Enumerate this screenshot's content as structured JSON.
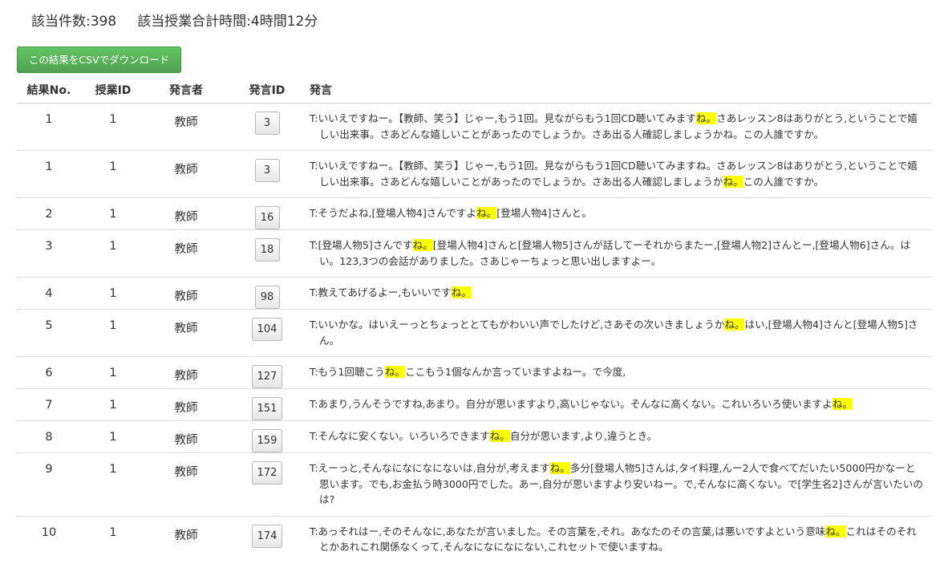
{
  "summary": {
    "count_label": "該当件数:",
    "count_value": "398",
    "time_label": "該当授業合計時間:",
    "time_value": "4時間12分"
  },
  "csv_button_label": "この結果をCSVでダウンロード",
  "table": {
    "headers": [
      "結果No.",
      "授業ID",
      "発言者",
      "発言ID",
      "発言"
    ],
    "rows": [
      {
        "no": "1",
        "class_id": "1",
        "speaker": "教師",
        "utt_id": "3",
        "pre": "T:いいえですねー。【教師、笑う】じゃー,もう1回。見ながらもう1回CD聴いてみます",
        "hit": "ね。",
        "post": "さあレッスン8はありがとう,ということで嬉しい出来事。さあどんな嬉しいことがあったのでしょうか。さあ出る人確認しましょうかね。この人誰ですか。"
      },
      {
        "no": "1",
        "class_id": "1",
        "speaker": "教師",
        "utt_id": "3",
        "pre": "T:いいえですねー。【教師、笑う】じゃー,もう1回。見ながらもう1回CD聴いてみますね。さあレッスン8はありがとう,ということで嬉しい出来事。さあどんな嬉しいことがあったのでしょうか。さあ出る人確認しましょうか",
        "hit": "ね。",
        "post": "この人誰ですか。"
      },
      {
        "no": "2",
        "class_id": "1",
        "speaker": "教師",
        "utt_id": "16",
        "pre": "T:そうだよね,[登場人物4]さんですよ",
        "hit": "ね。",
        "post": "[登場人物4]さんと。"
      },
      {
        "no": "3",
        "class_id": "1",
        "speaker": "教師",
        "utt_id": "18",
        "pre": "T:[登場人物5]さんです",
        "hit": "ね。",
        "post": "[登場人物4]さんと[登場人物5]さんが話してーそれからまたー,[登場人物2]さんとー,[登場人物6]さん。はい。123,3つの会話がありました。さあじゃーちょっと思い出しますよー。"
      },
      {
        "no": "4",
        "class_id": "1",
        "speaker": "教師",
        "utt_id": "98",
        "pre": "T:教えてあげるよー,もいいです",
        "hit": "ね。",
        "post": ""
      },
      {
        "no": "5",
        "class_id": "1",
        "speaker": "教師",
        "utt_id": "104",
        "pre": "T:いいかな。はいえーっとちょっととてもかわいい声でしたけど,さあその次いきましょうか",
        "hit": "ね。",
        "post": "はい,[登場人物4]さんと[登場人物5]さん。"
      },
      {
        "no": "6",
        "class_id": "1",
        "speaker": "教師",
        "utt_id": "127",
        "pre": "T:もう1回聴こう",
        "hit": "ね。",
        "post": "ここもう1個なんか言っていますよねー。で今度,"
      },
      {
        "no": "7",
        "class_id": "1",
        "speaker": "教師",
        "utt_id": "151",
        "pre": "T:あまり,うんそうですね,あまり。自分が思いますより,高いじゃない。そんなに高くない。これいろいろ使いますよ",
        "hit": "ね。",
        "post": ""
      },
      {
        "no": "8",
        "class_id": "1",
        "speaker": "教師",
        "utt_id": "159",
        "pre": "T:そんなに安くない。いろいろできます",
        "hit": "ね。",
        "post": "自分が思います,より,違うとき。"
      },
      {
        "no": "9",
        "class_id": "1",
        "speaker": "教師",
        "utt_id": "172",
        "pre": "T:えーっと,そんなになになにないは,自分が,考えます",
        "hit": "ね。",
        "post": "多分[登場人物5]さんは,タイ料理,んー2人で食べてだいたい5000円かなーと思います。でも,お金払う時3000円でした。あー,自分が思いますより安いねー。で,そんなに高くない。で[学生名2]さんが言いたいのは?"
      },
      {
        "no": "10",
        "class_id": "1",
        "speaker": "教師",
        "utt_id": "174",
        "pre": "T:あっそれはー,そのそんなに,あなたが言いました。その言葉を,それ。あなたのその言葉,は悪いですよという意味",
        "hit": "ね。",
        "post": "これはそのそれとかあれこれ関係なくって,そんなになになにない,これセットで使いますね。"
      }
    ]
  }
}
